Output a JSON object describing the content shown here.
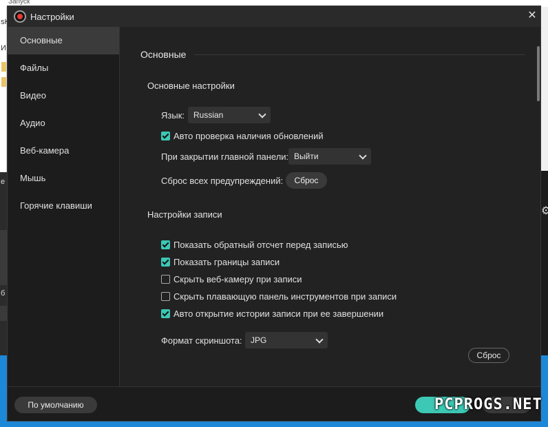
{
  "background": {
    "top_text": "Запуск",
    "left_marks": [
      "sK",
      "И",
      "е",
      "б"
    ],
    "right_icon": "gear-icon"
  },
  "window": {
    "title": "Настройки",
    "logo_icon": "record-icon",
    "close_icon": "close-icon",
    "close_glyph": "✕"
  },
  "sidebar": {
    "items": [
      {
        "label": "Основные",
        "active": true
      },
      {
        "label": "Файлы"
      },
      {
        "label": "Видео"
      },
      {
        "label": "Аудио"
      },
      {
        "label": "Веб-камера"
      },
      {
        "label": "Мышь"
      },
      {
        "label": "Горячие клавиши"
      }
    ]
  },
  "main": {
    "section_title": "Основные",
    "general": {
      "title": "Основные настройки",
      "language_label": "Язык:",
      "language_value": "Russian",
      "auto_update_label": "Авто проверка наличия обновлений",
      "auto_update_checked": true,
      "close_panel_label": "При закрытии главной панели:",
      "close_panel_value": "Выйти",
      "reset_warnings_label": "Сброс всех предупреждений:",
      "reset_warnings_button": "Сброс"
    },
    "recording": {
      "title": "Настройки записи",
      "options": [
        {
          "label": "Показать обратный отсчет перед записью",
          "checked": true
        },
        {
          "label": "Показать границы записи",
          "checked": true
        },
        {
          "label": "Скрыть веб-камеру при записи",
          "checked": false
        },
        {
          "label": "Скрыть плавающую панель инструментов при записи",
          "checked": false
        },
        {
          "label": "Авто открытие истории записи при ее завершении",
          "checked": true
        }
      ],
      "screenshot_format_label": "Формат скриншота:",
      "screenshot_format_value": "JPG",
      "reset_button": "Сброс"
    }
  },
  "footer": {
    "default_button": "По умолчанию",
    "watermark": "PCPROGS.NET"
  },
  "colors": {
    "accent": "#3cc8b4",
    "dialog_bg": "#1f1f1f",
    "sidebar_active": "#3b3b3b",
    "taskbar_blue": "#1e88d8"
  }
}
